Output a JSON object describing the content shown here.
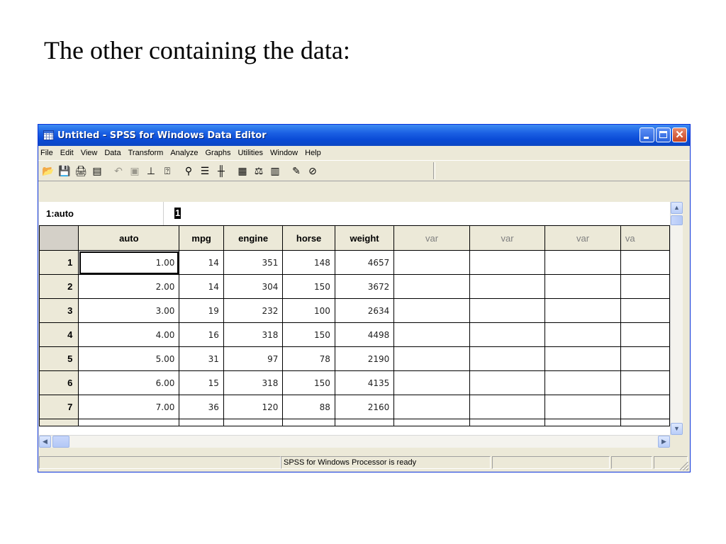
{
  "slide": {
    "title": "The other containing the data:"
  },
  "window": {
    "title": "Untitled - SPSS for Windows Data Editor"
  },
  "menu": [
    "File",
    "Edit",
    "View",
    "Data",
    "Transform",
    "Analyze",
    "Graphs",
    "Utilities",
    "Window",
    "Help"
  ],
  "toolbar": {
    "buttons": [
      {
        "name": "open-icon",
        "glyph": "📂"
      },
      {
        "name": "save-icon",
        "glyph": "💾"
      },
      {
        "name": "print-icon",
        "glyph": "🖨"
      },
      {
        "name": "dialog-recall-icon",
        "glyph": "▤"
      },
      {
        "name": "undo-icon",
        "glyph": "↶"
      },
      {
        "name": "goto-chart-icon",
        "glyph": "▣"
      },
      {
        "name": "goto-case-icon",
        "glyph": "⊥"
      },
      {
        "name": "variables-icon",
        "glyph": "⍰"
      },
      {
        "name": "find-icon",
        "glyph": "⚲"
      },
      {
        "name": "insert-cases-icon",
        "glyph": "☰"
      },
      {
        "name": "insert-variable-icon",
        "glyph": "╫"
      },
      {
        "name": "split-file-icon",
        "glyph": "▦"
      },
      {
        "name": "weight-cases-icon",
        "glyph": "⚖"
      },
      {
        "name": "select-cases-icon",
        "glyph": "▥"
      },
      {
        "name": "value-labels-icon",
        "glyph": "✎"
      },
      {
        "name": "use-sets-icon",
        "glyph": "⊘"
      }
    ]
  },
  "cell_editor": {
    "reference": "1:auto",
    "value": "1"
  },
  "grid": {
    "columns": [
      "auto",
      "mpg",
      "engine",
      "horse",
      "weight",
      "var",
      "var",
      "var",
      "va"
    ],
    "rows": [
      {
        "num": "1",
        "cells": [
          "1.00",
          "14",
          "351",
          "148",
          "4657"
        ]
      },
      {
        "num": "2",
        "cells": [
          "2.00",
          "14",
          "304",
          "150",
          "3672"
        ]
      },
      {
        "num": "3",
        "cells": [
          "3.00",
          "19",
          "232",
          "100",
          "2634"
        ]
      },
      {
        "num": "4",
        "cells": [
          "4.00",
          "16",
          "318",
          "150",
          "4498"
        ]
      },
      {
        "num": "5",
        "cells": [
          "5.00",
          "31",
          "97",
          "78",
          "2190"
        ]
      },
      {
        "num": "6",
        "cells": [
          "6.00",
          "15",
          "318",
          "150",
          "4135"
        ]
      },
      {
        "num": "7",
        "cells": [
          "7.00",
          "36",
          "120",
          "88",
          "2160"
        ]
      }
    ]
  },
  "status": {
    "message": "SPSS for Windows Processor is ready"
  }
}
